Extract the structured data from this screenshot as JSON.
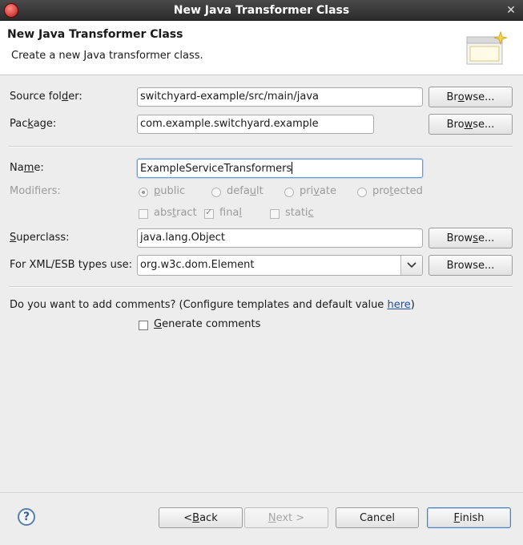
{
  "window": {
    "title": "New Java Transformer Class",
    "close_glyph": "✕",
    "app_icon": "eclipse-app-icon"
  },
  "header": {
    "title": "New Java Transformer Class",
    "description": "Create a new Java transformer class.",
    "banner_icon": "new-class-wizard-banner"
  },
  "source_folder": {
    "label_pre": "Source fol",
    "label_mnemonic": "d",
    "label_post": "er:",
    "value": "switchyard-example/src/main/java",
    "browse_pre": "Br",
    "browse_mnemonic": "o",
    "browse_post": "wse..."
  },
  "package": {
    "label_pre": "Pac",
    "label_mnemonic": "k",
    "label_post": "age:",
    "value": "com.example.switchyard.example",
    "browse_pre": "Bro",
    "browse_mnemonic": "w",
    "browse_post": "se..."
  },
  "name": {
    "label_pre": "Na",
    "label_mnemonic": "m",
    "label_post": "e:",
    "value": "ExampleServiceTransformers"
  },
  "modifiers": {
    "label": "Modifiers:",
    "access": [
      {
        "pre": "",
        "mn": "p",
        "post": "ublic",
        "selected": true
      },
      {
        "pre": "defa",
        "mn": "u",
        "post": "lt",
        "selected": false
      },
      {
        "pre": "pri",
        "mn": "v",
        "post": "ate",
        "selected": false
      },
      {
        "pre": "pro",
        "mn": "t",
        "post": "ected",
        "selected": false
      }
    ],
    "flags": [
      {
        "pre": "abs",
        "mn": "t",
        "post": "ract",
        "checked": false
      },
      {
        "pre": "fina",
        "mn": "l",
        "post": "",
        "checked": true
      },
      {
        "pre": "stati",
        "mn": "c",
        "post": "",
        "checked": false
      }
    ]
  },
  "superclass": {
    "label_pre": "",
    "label_mnemonic": "S",
    "label_post": "uperclass:",
    "value": "java.lang.Object",
    "browse_pre": "Brow",
    "browse_mnemonic": "s",
    "browse_post": "e..."
  },
  "xml_types": {
    "label": "For XML/ESB types use:",
    "value": "org.w3c.dom.Element",
    "browse_label": "Browse..."
  },
  "comments": {
    "question_pre": "Do you want to add comments? (Configure templates and default value ",
    "link": "here",
    "question_post": ")",
    "checkbox_pre": "",
    "checkbox_mnemonic": "G",
    "checkbox_post": "enerate comments",
    "checked": false
  },
  "footer": {
    "help_glyph": "?",
    "back": {
      "pre": "< ",
      "mn": "B",
      "post": "ack"
    },
    "next": {
      "pre": "",
      "mn": "N",
      "post": "ext >"
    },
    "cancel": "Cancel",
    "finish": {
      "pre": "",
      "mn": "F",
      "post": "inish"
    }
  }
}
